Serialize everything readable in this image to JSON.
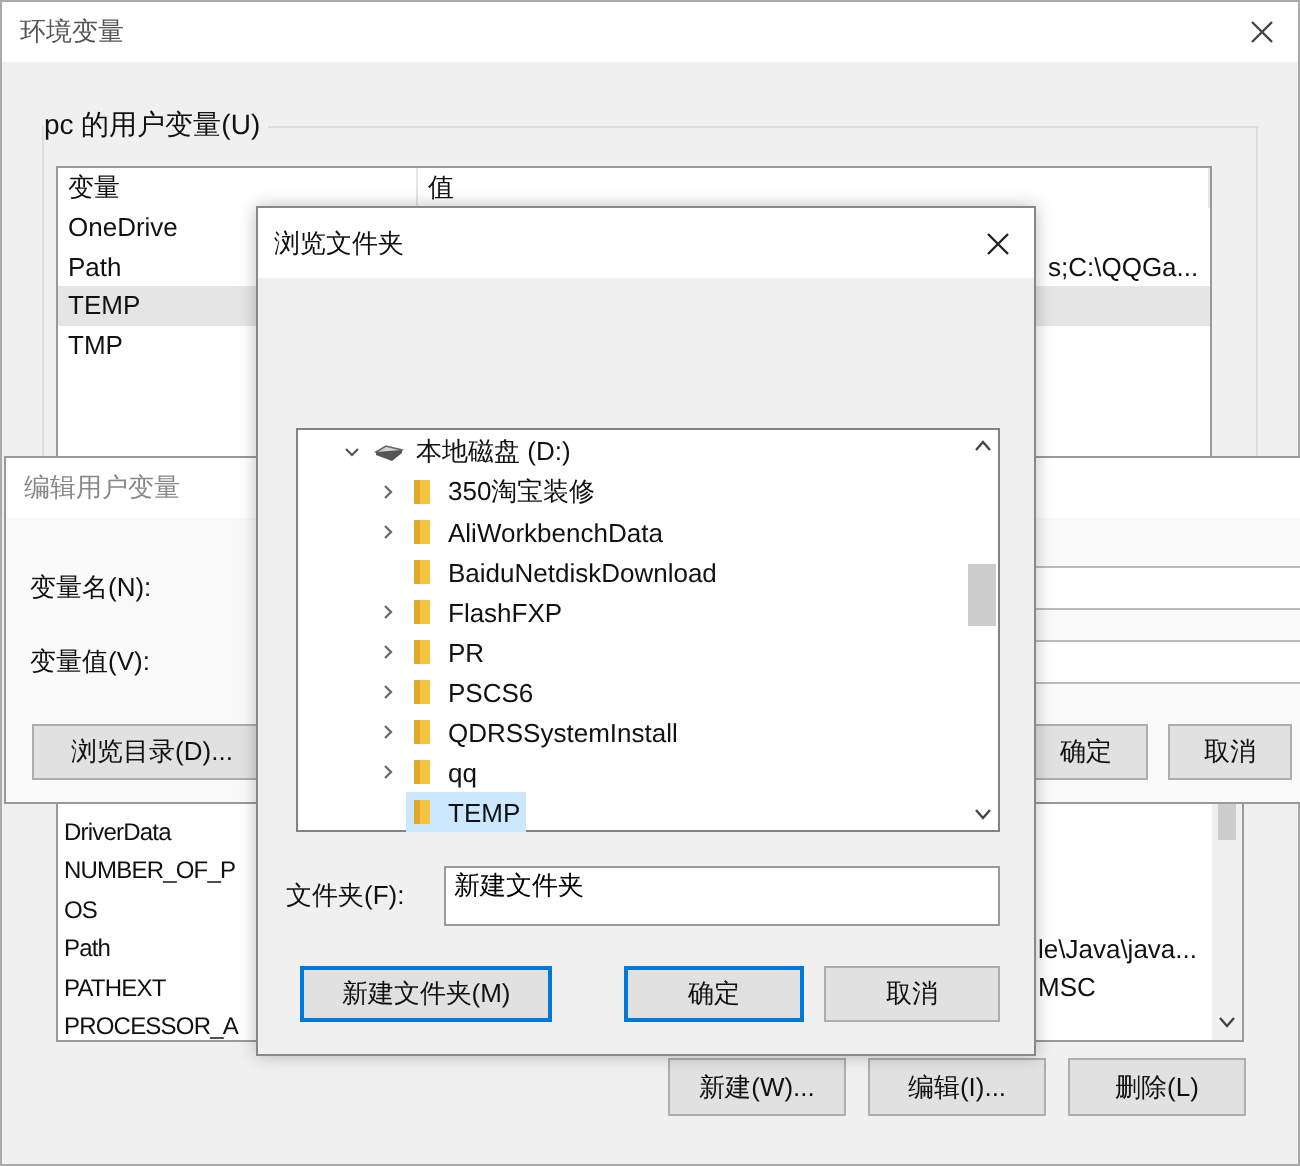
{
  "env_window": {
    "title": "环境变量",
    "user_group": {
      "label": "pc 的用户变量(U)",
      "columns": [
        "变量",
        "值"
      ],
      "rows": [
        {
          "name": "OneDrive",
          "selected": false
        },
        {
          "name": "Path",
          "value": "s;C:\\QQGa...",
          "selected": false
        },
        {
          "name": "TEMP",
          "selected": true
        },
        {
          "name": "TMP",
          "selected": false
        }
      ]
    },
    "system_rows": [
      {
        "name": "DriverData",
        "selected": false
      },
      {
        "name": "NUMBER_OF_P",
        "selected": false
      },
      {
        "name": "OS",
        "selected": false
      },
      {
        "name": "Path",
        "value": "le\\Java\\java...",
        "selected": false
      },
      {
        "name": "PATHEXT",
        "value": "MSC",
        "selected": false
      },
      {
        "name": "PROCESSOR_A",
        "selected": false
      }
    ],
    "buttons": [
      {
        "label": "新建(W)..."
      },
      {
        "label": "编辑(I)..."
      },
      {
        "label": "删除(L)"
      }
    ]
  },
  "edit_dialog": {
    "title": "编辑用户变量",
    "fields": [
      {
        "label": "变量名(N):"
      },
      {
        "label": "变量值(V):"
      }
    ],
    "browse_button": "浏览目录(D)...",
    "buttons": [
      {
        "label": "确定"
      },
      {
        "label": "取消"
      }
    ]
  },
  "browse_dialog": {
    "title": "浏览文件夹",
    "tree": {
      "label": "本地磁盘 (D:)",
      "expanded": true,
      "children": [
        {
          "label": "350淘宝装修",
          "has_children": true,
          "selected": false
        },
        {
          "label": "AliWorkbenchData",
          "has_children": true,
          "selected": false
        },
        {
          "label": "BaiduNetdiskDownload",
          "has_children": false,
          "selected": false
        },
        {
          "label": "FlashFXP",
          "has_children": true,
          "selected": false
        },
        {
          "label": "PR",
          "has_children": true,
          "selected": false
        },
        {
          "label": "PSCS6",
          "has_children": true,
          "selected": false
        },
        {
          "label": "QDRSSystemInstall",
          "has_children": true,
          "selected": false
        },
        {
          "label": "qq",
          "has_children": true,
          "selected": false
        },
        {
          "label": "TEMP",
          "has_children": false,
          "selected": true
        }
      ]
    },
    "folder_field": {
      "label": "文件夹(F):",
      "value": "新建文件夹"
    },
    "buttons": [
      {
        "label": "新建文件夹(M)",
        "focused": true
      },
      {
        "label": "确定",
        "focused": true
      },
      {
        "label": "取消",
        "focused": false
      }
    ]
  }
}
